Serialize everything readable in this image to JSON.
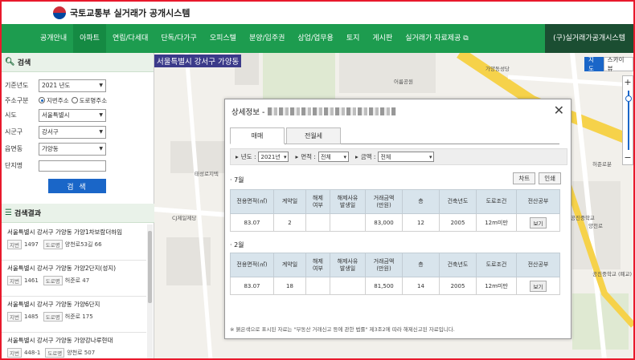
{
  "header": {
    "org": "국토교통부",
    "system": "실거래가 공개시스템"
  },
  "nav": {
    "items": [
      "공개안내",
      "아파트",
      "연립/다세대",
      "단독/다가구",
      "오피스텔",
      "분양/입주권",
      "상업/업무용",
      "토지",
      "게시판",
      "실거래가 자료제공 ⧉"
    ],
    "active": "아파트",
    "special": "(구)실거래가공개시스템"
  },
  "search": {
    "title": "검색",
    "year_label": "기준년도",
    "year_value": "2021 년도",
    "addr_label": "주소구분",
    "addr_opt1": "지번주소",
    "addr_opt2": "도로명주소",
    "city_label": "시도",
    "city_value": "서울특별시",
    "district_label": "시군구",
    "district_value": "강서구",
    "dong_label": "읍면동",
    "dong_value": "가양동",
    "complex_label": "단지명",
    "button": "검 색"
  },
  "results": {
    "title": "검색결과",
    "jibun_tag": "지번",
    "road_tag": "도로명",
    "items": [
      {
        "title": "서울특별시 강서구 가양동 가양1차보람더하임",
        "jibun": "1497",
        "road": "양천로53길 66"
      },
      {
        "title": "서울특별시 강서구 가양동 가양2단지(성지)",
        "jibun": "1461",
        "road": "허준로 47"
      },
      {
        "title": "서울특별시 강서구 가양동 가양6단지",
        "jibun": "1485",
        "road": "허준로 175"
      },
      {
        "title": "서울특별시 강서구 가양동 가양강나루현대",
        "jibun": "448-1",
        "road": "양천로 507"
      }
    ]
  },
  "map": {
    "location": "서울특별시 강서구 가양동",
    "labels": {
      "park": "어름공원",
      "police": "가양동성당",
      "tower": "태성로지텍",
      "cj": "CJ제일제당",
      "hurjun": "허준로",
      "hjpark": "허준로분",
      "school": "공진중학교",
      "yangcheon": "양천로",
      "gonjin": "공진중학교\n(폐교)"
    },
    "btn_map": "지도",
    "btn_sky": "스카이뷰",
    "zoom_in": "+",
    "zoom_out": "−"
  },
  "modal": {
    "title": "상세정보 -",
    "close": "✕",
    "tab_sale": "매매",
    "tab_rent": "전월세",
    "filter": {
      "year_label": "년도 :",
      "year_value": "2021년",
      "area_label": "면적 :",
      "area_value": "전체",
      "price_label": "금액 :",
      "price_value": "전체"
    },
    "chart_btn": "차트",
    "print_btn": "인쇄",
    "columns": [
      "전용면적(㎡)",
      "계약일",
      "해제\n여부",
      "해제사유\n발생일",
      "거래금액\n(만원)",
      "층",
      "건축년도",
      "도로조건",
      "전산공부"
    ],
    "groups": [
      {
        "month": "7월",
        "rows": [
          [
            "83.07",
            "2",
            "",
            "",
            "83,000",
            "12",
            "2005",
            "12m미만",
            "보기"
          ]
        ]
      },
      {
        "month": "2월",
        "rows": [
          [
            "83.07",
            "18",
            "",
            "",
            "81,500",
            "14",
            "2005",
            "12m미만",
            "보기"
          ]
        ]
      }
    ],
    "note": "※ 붉은색으로 표시된 자료는 \"부동산 거래신고 등에 관한 법률\" 제3조2에 따라 해제신고된 자료입니다."
  }
}
